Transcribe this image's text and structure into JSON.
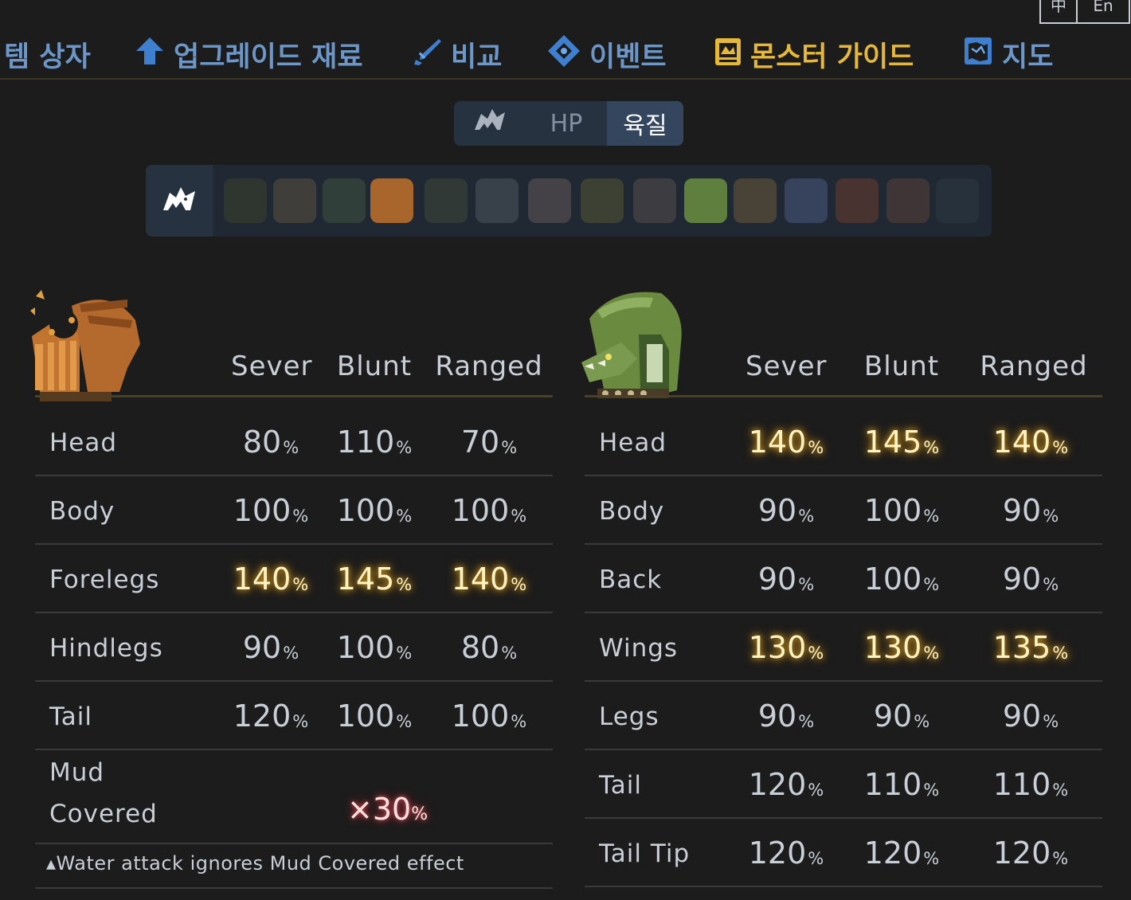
{
  "lang": {
    "zh": "中",
    "en": "En"
  },
  "nav": {
    "items": [
      {
        "label": "템 상자",
        "icon": "box-icon"
      },
      {
        "label": "업그레이드 재료",
        "icon": "upgrade-arrow-icon"
      },
      {
        "label": "비교",
        "icon": "sword-icon"
      },
      {
        "label": "이벤트",
        "icon": "event-diamond-icon"
      },
      {
        "label": "몬스터 가이드",
        "icon": "monster-guide-icon",
        "active": true
      },
      {
        "label": "지도",
        "icon": "map-icon"
      }
    ],
    "active_color": "#e6b83a",
    "color": "#6c97c8"
  },
  "toggle": {
    "icon": "monster-icon",
    "hp": "HP",
    "hitzone": "육질"
  },
  "monster_selector": {
    "icons": [
      "wyvern-icon",
      "monster-1-icon",
      "monster-2-icon",
      "monster-3-icon",
      "barroth-icon",
      "monster-5-icon",
      "monster-6-icon",
      "monster-7-icon",
      "monster-8-icon",
      "monster-9-icon",
      "rathian-icon",
      "monster-11-icon",
      "monster-12-icon",
      "monster-13-icon",
      "monster-14-icon",
      "monster-15-icon"
    ]
  },
  "left_table": {
    "monster_icon": "barroth-icon",
    "columns": [
      "Sever",
      "Blunt",
      "Ranged"
    ],
    "rows": [
      {
        "part": "Head",
        "values": [
          "80",
          "110",
          "70"
        ],
        "weak": false
      },
      {
        "part": "Body",
        "values": [
          "100",
          "100",
          "100"
        ],
        "weak": false
      },
      {
        "part": "Forelegs",
        "values": [
          "140",
          "145",
          "140"
        ],
        "weak": true
      },
      {
        "part": "Hindlegs",
        "values": [
          "90",
          "100",
          "80"
        ],
        "weak": false
      },
      {
        "part": "Tail",
        "values": [
          "120",
          "100",
          "100"
        ],
        "weak": false
      }
    ],
    "special": {
      "part_line1": "Mud",
      "part_line2": "Covered",
      "value": "×30",
      "unit": "%"
    },
    "note": "▴Water attack ignores Mud Covered effect"
  },
  "right_table": {
    "monster_icon": "rathian-icon",
    "columns": [
      "Sever",
      "Blunt",
      "Ranged"
    ],
    "rows": [
      {
        "part": "Head",
        "values": [
          "140",
          "145",
          "140"
        ],
        "weak": true
      },
      {
        "part": "Body",
        "values": [
          "90",
          "100",
          "90"
        ],
        "weak": false
      },
      {
        "part": "Back",
        "values": [
          "90",
          "100",
          "90"
        ],
        "weak": false
      },
      {
        "part": "Wings",
        "values": [
          "130",
          "130",
          "135"
        ],
        "weak": true
      },
      {
        "part": "Legs",
        "values": [
          "90",
          "90",
          "90"
        ],
        "weak": false
      },
      {
        "part": "Tail",
        "values": [
          "120",
          "110",
          "110"
        ],
        "weak": false
      },
      {
        "part": "Tail Tip",
        "values": [
          "120",
          "120",
          "120"
        ],
        "weak": false
      }
    ]
  },
  "unit": "%"
}
